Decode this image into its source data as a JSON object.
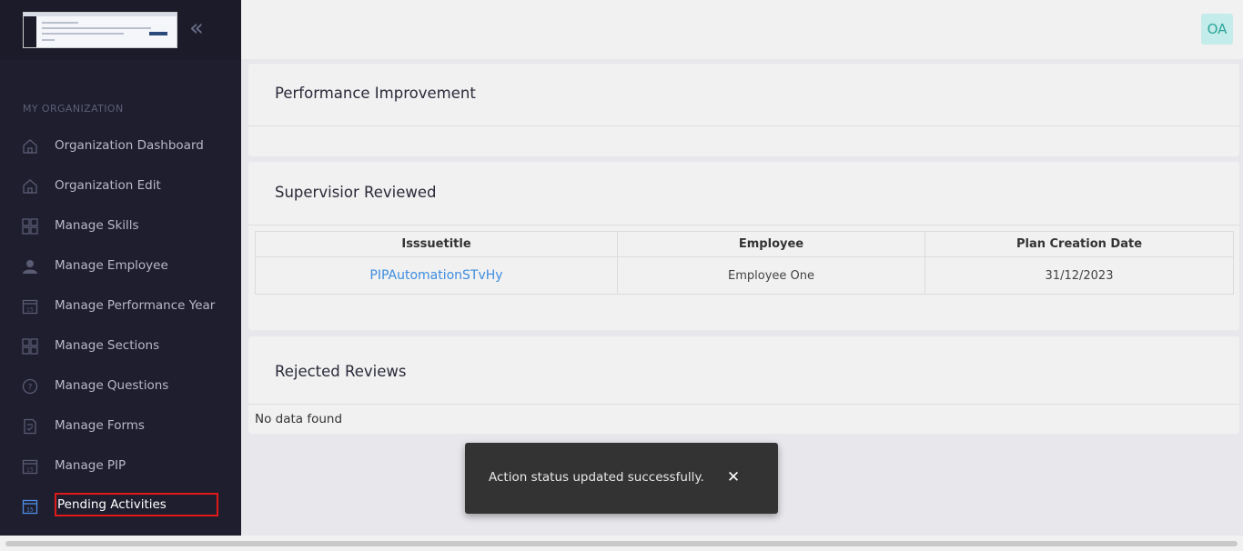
{
  "sidebar": {
    "section_label": "MY ORGANIZATION",
    "collapse_icon": "double-chevron-left-icon",
    "items": [
      {
        "label": "Organization Dashboard",
        "icon": "home-icon"
      },
      {
        "label": "Organization Edit",
        "icon": "home-icon"
      },
      {
        "label": "Manage Skills",
        "icon": "grid-icon"
      },
      {
        "label": "Manage Employee",
        "icon": "user-icon"
      },
      {
        "label": "Manage Performance Year",
        "icon": "calendar-icon"
      },
      {
        "label": "Manage Sections",
        "icon": "grid-icon"
      },
      {
        "label": "Manage Questions",
        "icon": "question-icon"
      },
      {
        "label": "Manage Forms",
        "icon": "form-icon"
      },
      {
        "label": "Manage PIP",
        "icon": "calendar-icon"
      },
      {
        "label": "Pending Activities",
        "icon": "calendar-icon",
        "active": true
      }
    ]
  },
  "header": {
    "avatar_initials": "OA"
  },
  "cards": {
    "performance": {
      "title": "Performance Improvement"
    },
    "reviewed": {
      "title": "Supervisior Reviewed",
      "columns": [
        "Isssuetitle",
        "Employee",
        "Plan Creation Date"
      ],
      "rows": [
        {
          "issue": "PIPAutomationSTvHy",
          "employee": "Employee One",
          "date": "31/12/2023"
        }
      ]
    },
    "rejected": {
      "title": "Rejected Reviews",
      "empty_text": "No data found"
    }
  },
  "toast": {
    "message": "Action status updated successfully.",
    "close_icon": "close-icon"
  },
  "colors": {
    "sidebar_bg": "#1f1e2e",
    "link": "#3d8de0",
    "avatar_bg": "#c4ecea",
    "avatar_text": "#2aa59b",
    "highlight_border": "#e01919"
  }
}
